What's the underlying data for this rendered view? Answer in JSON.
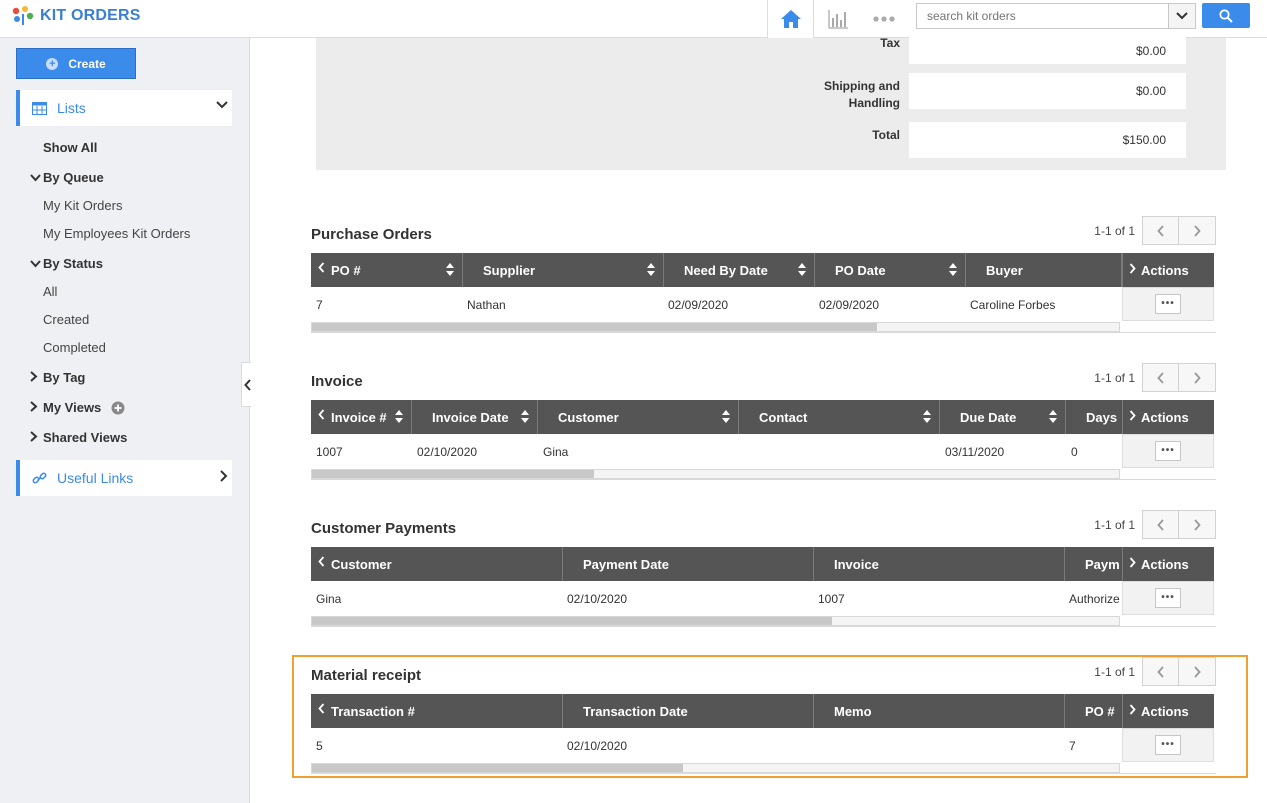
{
  "app": {
    "title": "KIT ORDERS"
  },
  "search": {
    "placeholder": "search kit orders"
  },
  "sidebar": {
    "create_label": "Create",
    "lists_label": "Lists",
    "show_all": "Show All",
    "by_queue": "By Queue",
    "queue_items": [
      "My Kit Orders",
      "My Employees Kit Orders"
    ],
    "by_status": "By Status",
    "status_items": [
      "All",
      "Created",
      "Completed"
    ],
    "by_tag": "By Tag",
    "my_views": "My Views",
    "shared_views": "Shared Views",
    "useful_links": "Useful Links"
  },
  "totals": {
    "tax_label": "Tax",
    "tax_value": "$0.00",
    "shipping_label_1": "Shipping and",
    "shipping_label_2": "Handling",
    "shipping_value": "$0.00",
    "total_label": "Total",
    "total_value": "$150.00"
  },
  "purchase_orders": {
    "title": "Purchase Orders",
    "pager": "1-1 of 1",
    "columns": [
      "PO #",
      "Supplier",
      "Need By Date",
      "PO Date",
      "Buyer"
    ],
    "actions_label": "Actions",
    "row": [
      "7",
      "Nathan",
      "02/09/2020",
      "02/09/2020",
      "Caroline Forbes"
    ]
  },
  "invoice": {
    "title": "Invoice",
    "pager": "1-1 of 1",
    "columns": [
      "Invoice #",
      "Invoice Date",
      "Customer",
      "Contact",
      "Due Date",
      "Days"
    ],
    "actions_label": "Actions",
    "row": [
      "1007",
      "02/10/2020",
      "Gina",
      "",
      "03/11/2020",
      "0"
    ]
  },
  "customer_payments": {
    "title": "Customer Payments",
    "pager": "1-1 of 1",
    "columns": [
      "Customer",
      "Payment Date",
      "Invoice",
      "Paym"
    ],
    "actions_label": "Actions",
    "row": [
      "Gina",
      "02/10/2020",
      "1007",
      "Authorize"
    ]
  },
  "material_receipt": {
    "title": "Material receipt",
    "pager": "1-1 of 1",
    "columns": [
      "Transaction #",
      "Transaction Date",
      "Memo",
      "PO #"
    ],
    "actions_label": "Actions",
    "row": [
      "5",
      "02/10/2020",
      "",
      "7"
    ]
  },
  "colors": {
    "accent": "#3b8bea",
    "header_bg": "#555555",
    "highlight": "#f0a030"
  }
}
